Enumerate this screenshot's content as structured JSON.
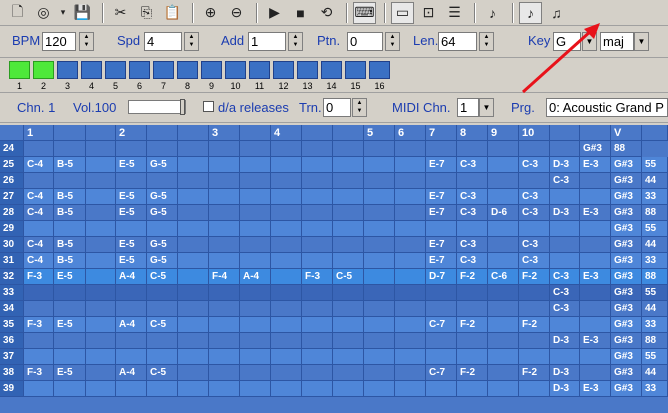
{
  "toolbar": {
    "buttons": [
      {
        "name": "new-file-icon",
        "glyph": "🗋"
      },
      {
        "name": "open-file-icon",
        "glyph": "◎"
      },
      {
        "name": "dropdown-arrow-icon",
        "glyph": "▾"
      },
      {
        "name": "save-icon",
        "glyph": "💾"
      },
      {
        "name": "cut-icon",
        "glyph": "✂"
      },
      {
        "name": "copy-icon",
        "glyph": "⎘"
      },
      {
        "name": "paste-icon",
        "glyph": "📋"
      },
      {
        "name": "zoom-in-icon",
        "glyph": "⊕"
      },
      {
        "name": "zoom-out-icon",
        "glyph": "⊖"
      },
      {
        "name": "play-icon",
        "glyph": "▶"
      },
      {
        "name": "stop-icon",
        "glyph": "■"
      },
      {
        "name": "loop-icon",
        "glyph": "⟲"
      },
      {
        "name": "keyboard-icon",
        "glyph": "⌨"
      },
      {
        "name": "window-icon",
        "glyph": "▭"
      },
      {
        "name": "frame-icon",
        "glyph": "⊡"
      },
      {
        "name": "split-view-icon",
        "glyph": "☰"
      },
      {
        "name": "instrument-icon",
        "glyph": "♪"
      },
      {
        "name": "single-note-icon",
        "glyph": "♪"
      },
      {
        "name": "double-note-icon",
        "glyph": "♫"
      }
    ]
  },
  "controls": {
    "bpm_label": "BPM",
    "bpm_value": "120",
    "spd_label": "Spd",
    "spd_value": "4",
    "add_label": "Add",
    "add_value": "1",
    "ptn_label": "Ptn.",
    "ptn_value": "0",
    "len_label": "Len.",
    "len_value": "64",
    "key_label": "Key",
    "key_value": "G",
    "mode_value": "maj"
  },
  "patterns": {
    "labels": [
      "1",
      "2",
      "3",
      "4",
      "5",
      "6",
      "7",
      "8",
      "9",
      "10",
      "11",
      "12",
      "13",
      "14",
      "15",
      "16"
    ],
    "active": [
      true,
      true,
      false,
      false,
      false,
      false,
      false,
      false,
      false,
      false,
      false,
      false,
      false,
      false,
      false,
      false
    ]
  },
  "channel": {
    "chn_label": "Chn. 1",
    "vol_label": "Vol.100",
    "vol_level": 1.0,
    "release_label": "d/a releases",
    "trn_label": "Trn.",
    "trn_value": "0",
    "midi_label": "MIDI Chn.",
    "midi_value": "1",
    "prg_label": "Prg.",
    "prg_value": "0: Acoustic Grand P"
  },
  "grid": {
    "headers": [
      "",
      "1",
      "",
      "",
      "2",
      "",
      "",
      "3",
      "",
      "4",
      "",
      "",
      "5",
      "6",
      "7",
      "8",
      "9",
      "10",
      "",
      "",
      "V"
    ],
    "rows": [
      {
        "n": "24",
        "c": [
          "",
          "",
          "",
          "",
          "",
          "",
          "",
          "",
          "",
          "",
          "",
          "",
          "",
          "",
          "",
          "",
          "",
          "",
          "G#3",
          "88"
        ]
      },
      {
        "n": "25",
        "c": [
          "C-4",
          "B-5",
          "",
          "E-5",
          "G-5",
          "",
          "",
          "",
          "",
          "",
          "",
          "",
          "",
          "E-7",
          "C-3",
          "",
          "C-3",
          "D-3",
          "E-3",
          "G#3",
          "55"
        ]
      },
      {
        "n": "26",
        "c": [
          "",
          "",
          "",
          "",
          "",
          "",
          "",
          "",
          "",
          "",
          "",
          "",
          "",
          "",
          "",
          "",
          "",
          "C-3",
          "",
          "G#3",
          "44"
        ]
      },
      {
        "n": "27",
        "c": [
          "C-4",
          "B-5",
          "",
          "E-5",
          "G-5",
          "",
          "",
          "",
          "",
          "",
          "",
          "",
          "",
          "E-7",
          "C-3",
          "",
          "C-3",
          "",
          "",
          "G#3",
          "33"
        ]
      },
      {
        "n": "28",
        "c": [
          "C-4",
          "B-5",
          "",
          "E-5",
          "G-5",
          "",
          "",
          "",
          "",
          "",
          "",
          "",
          "",
          "E-7",
          "C-3",
          "D-6",
          "C-3",
          "D-3",
          "E-3",
          "G#3",
          "88"
        ]
      },
      {
        "n": "29",
        "c": [
          "",
          "",
          "",
          "",
          "",
          "",
          "",
          "",
          "",
          "",
          "",
          "",
          "",
          "",
          "",
          "",
          "",
          "",
          "",
          "G#3",
          "55"
        ]
      },
      {
        "n": "30",
        "c": [
          "C-4",
          "B-5",
          "",
          "E-5",
          "G-5",
          "",
          "",
          "",
          "",
          "",
          "",
          "",
          "",
          "E-7",
          "C-3",
          "",
          "C-3",
          "",
          "",
          "G#3",
          "44"
        ]
      },
      {
        "n": "31",
        "c": [
          "C-4",
          "B-5",
          "",
          "E-5",
          "G-5",
          "",
          "",
          "",
          "",
          "",
          "",
          "",
          "",
          "E-7",
          "C-3",
          "",
          "C-3",
          "",
          "",
          "G#3",
          "33"
        ]
      },
      {
        "n": "32",
        "c": [
          "F-3",
          "E-5",
          "",
          "A-4",
          "C-5",
          "",
          "F-4",
          "A-4",
          "",
          "F-3",
          "C-5",
          "",
          "",
          "D-7",
          "F-2",
          "C-6",
          "F-2",
          "C-3",
          "E-3",
          "G#3",
          "88"
        ]
      },
      {
        "n": "33",
        "c": [
          "",
          "",
          "",
          "",
          "",
          "",
          "",
          "",
          "",
          "",
          "",
          "",
          "",
          "",
          "",
          "",
          "",
          "C-3",
          "",
          "G#3",
          "55"
        ]
      },
      {
        "n": "34",
        "c": [
          "",
          "",
          "",
          "",
          "",
          "",
          "",
          "",
          "",
          "",
          "",
          "",
          "",
          "",
          "",
          "",
          "",
          "C-3",
          "",
          "G#3",
          "44"
        ]
      },
      {
        "n": "35",
        "c": [
          "F-3",
          "E-5",
          "",
          "A-4",
          "C-5",
          "",
          "",
          "",
          "",
          "",
          "",
          "",
          "",
          "C-7",
          "F-2",
          "",
          "F-2",
          "",
          "",
          "G#3",
          "33"
        ]
      },
      {
        "n": "36",
        "c": [
          "",
          "",
          "",
          "",
          "",
          "",
          "",
          "",
          "",
          "",
          "",
          "",
          "",
          "",
          "",
          "",
          "",
          "D-3",
          "E-3",
          "G#3",
          "88"
        ]
      },
      {
        "n": "37",
        "c": [
          "",
          "",
          "",
          "",
          "",
          "",
          "",
          "",
          "",
          "",
          "",
          "",
          "",
          "",
          "",
          "",
          "",
          "",
          "",
          "G#3",
          "55"
        ]
      },
      {
        "n": "38",
        "c": [
          "F-3",
          "E-5",
          "",
          "A-4",
          "C-5",
          "",
          "",
          "",
          "",
          "",
          "",
          "",
          "",
          "C-7",
          "F-2",
          "",
          "F-2",
          "D-3",
          "",
          "G#3",
          "44"
        ]
      },
      {
        "n": "39",
        "c": [
          "",
          "",
          "",
          "",
          "",
          "",
          "",
          "",
          "",
          "",
          "",
          "",
          "",
          "",
          "",
          "",
          "",
          "D-3",
          "E-3",
          "G#3",
          "33"
        ]
      }
    ]
  }
}
